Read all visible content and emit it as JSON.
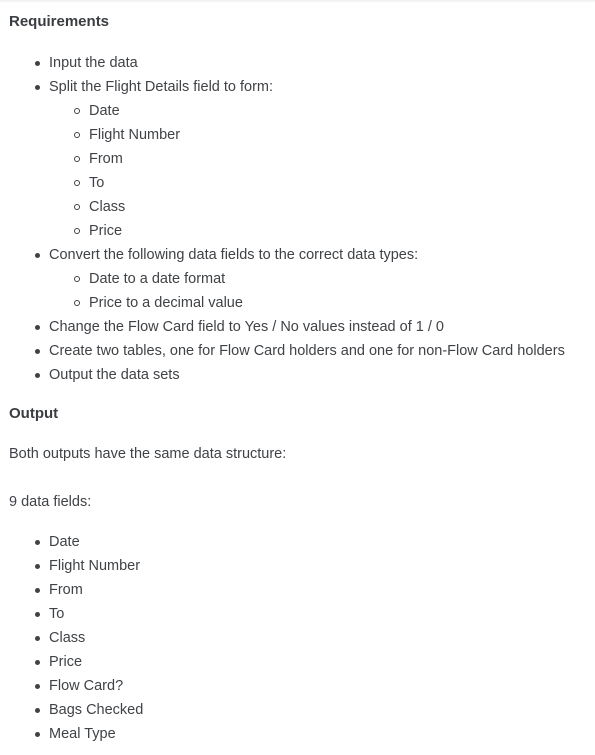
{
  "requirements": {
    "heading": "Requirements",
    "items": [
      "Input the data",
      "Split the Flight Details field to form:",
      "Convert the following data fields to the correct data types:",
      "Change the Flow Card field to Yes / No values instead of 1 / 0",
      "Create two tables, one for Flow Card holders and one for non-Flow Card holders",
      "Output the data sets"
    ],
    "split_subitems": [
      "Date",
      "Flight Number",
      "From",
      "To",
      "Class",
      "Price"
    ],
    "convert_subitems": [
      "Date to a date format",
      "Price to a decimal value"
    ]
  },
  "output": {
    "heading": "Output",
    "intro": "Both outputs have the same data structure:",
    "fields_label": "9 data fields:",
    "fields": [
      "Date",
      "Flight Number",
      "From",
      "To",
      "Class",
      "Price",
      "Flow Card?",
      "Bags Checked",
      "Meal Type"
    ]
  }
}
